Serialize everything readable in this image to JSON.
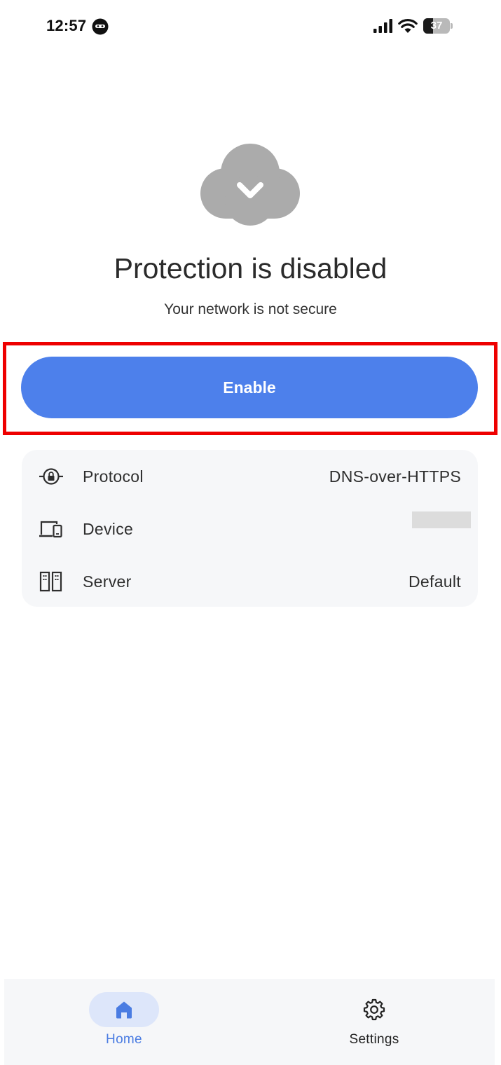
{
  "status_bar": {
    "time": "12:57",
    "battery_level": "37",
    "battery_fraction": 0.37,
    "icons": [
      "app-notification-icon",
      "cellular-signal-icon",
      "wifi-icon",
      "battery-icon"
    ]
  },
  "hero": {
    "icon": "cloud-check-icon",
    "icon_color": "#ababab",
    "title": "Protection is disabled",
    "subtitle": "Your network is not secure"
  },
  "enable_button": {
    "label": "Enable",
    "color": "#4d80eb",
    "highlight_color": "#ee0000"
  },
  "info": {
    "rows": [
      {
        "icon": "protocol-lock-icon",
        "label": "Protocol",
        "value": "DNS-over-HTTPS"
      },
      {
        "icon": "devices-icon",
        "label": "Device",
        "value": ""
      },
      {
        "icon": "server-icon",
        "label": "Server",
        "value": "Default"
      }
    ]
  },
  "bottom_nav": {
    "active_color": "#4a7ce2",
    "items": [
      {
        "icon": "home-icon",
        "label": "Home",
        "active": true
      },
      {
        "icon": "gear-icon",
        "label": "Settings",
        "active": false
      }
    ]
  }
}
